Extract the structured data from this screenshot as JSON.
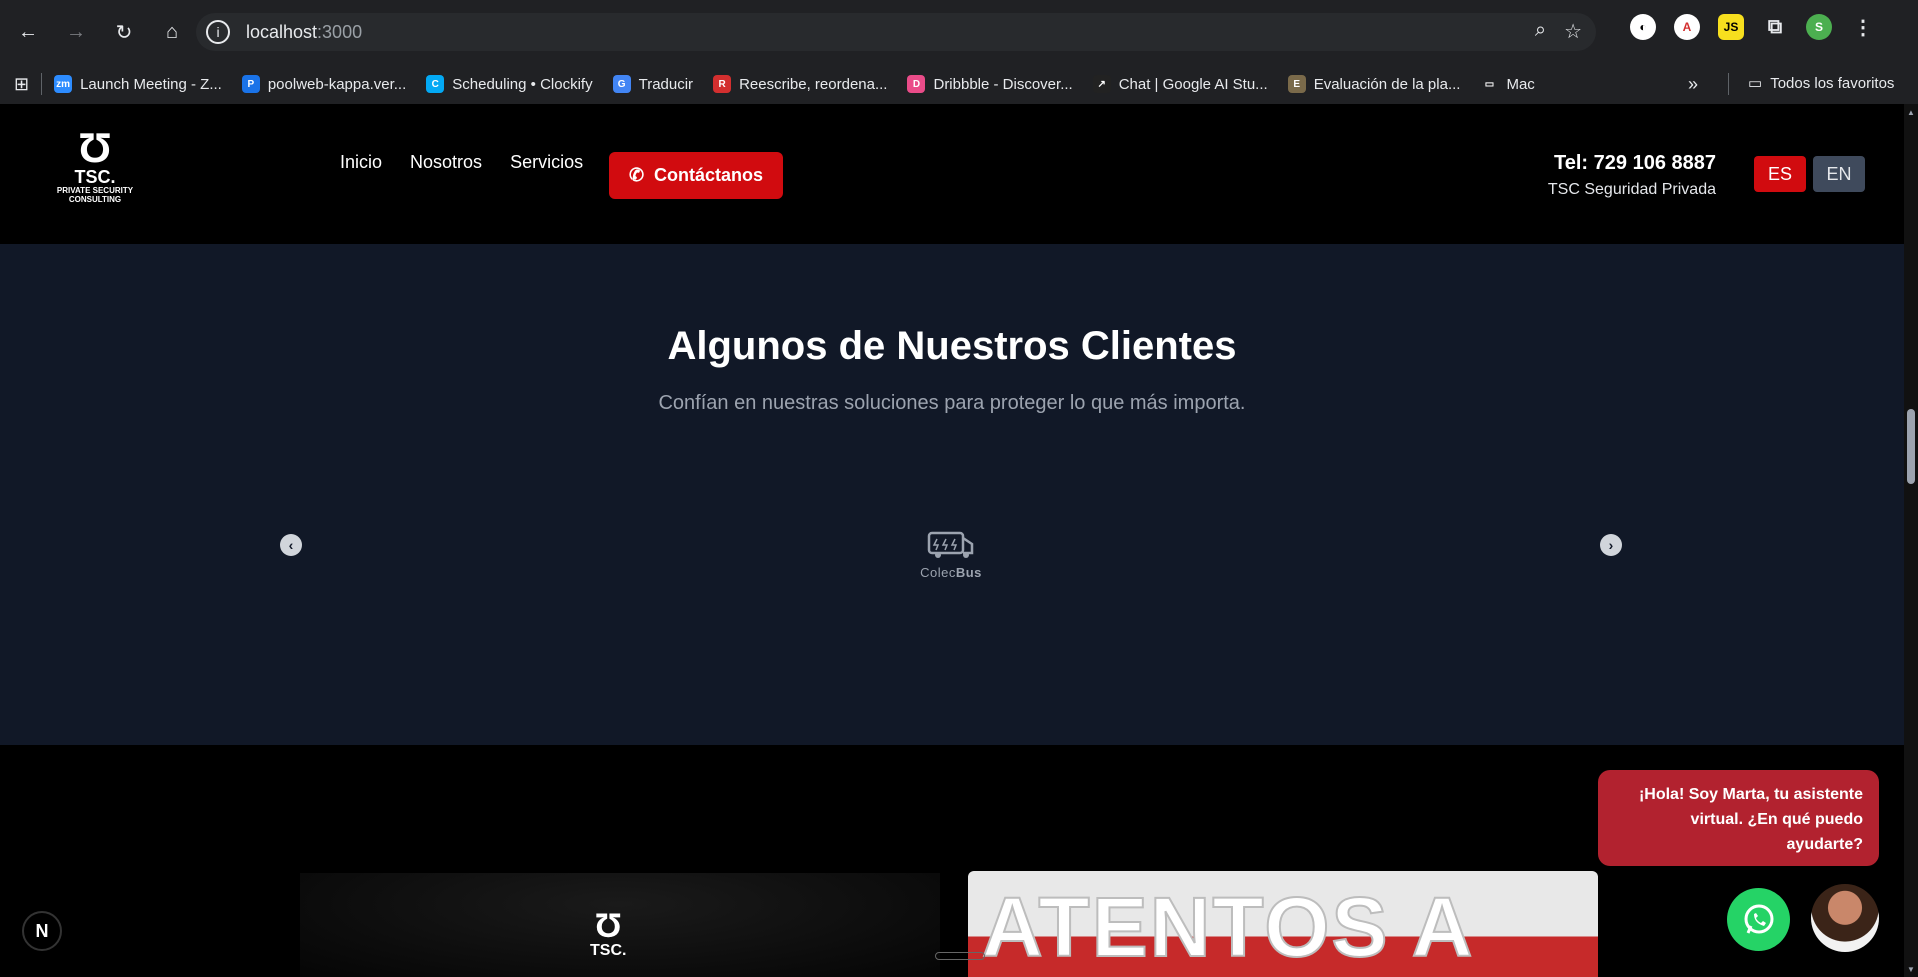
{
  "browser": {
    "url_host": "localhost",
    "url_port": ":3000",
    "avatar_letter": "S",
    "bookmarks": [
      {
        "label": "Launch Meeting - Z...",
        "icon": "zoom-icon",
        "color": "#2d8cff",
        "glyph": "zm"
      },
      {
        "label": "poolweb-kappa.ver...",
        "icon": "p-icon",
        "color": "#1a73e8",
        "glyph": "P"
      },
      {
        "label": "Scheduling • Clockify",
        "icon": "clockify-icon",
        "color": "#03a9f4",
        "glyph": "C"
      },
      {
        "label": "Traducir",
        "icon": "translate-icon",
        "color": "#4285f4",
        "glyph": "G"
      },
      {
        "label": "Reescribe, reordena...",
        "icon": "rewrite-icon",
        "color": "#d32f2f",
        "glyph": "R"
      },
      {
        "label": "Dribbble - Discover...",
        "icon": "dribbble-icon",
        "color": "#ea4c89",
        "glyph": "D"
      },
      {
        "label": "Chat | Google AI Stu...",
        "icon": "ai-studio-icon",
        "color": "#222222",
        "glyph": "↗"
      },
      {
        "label": "Evaluación de la pla...",
        "icon": "evaluacion-icon",
        "color": "#7a6a4a",
        "glyph": "E"
      },
      {
        "label": "Mac",
        "icon": "folder-icon",
        "color": "#202124",
        "glyph": "▭"
      }
    ],
    "all_bookmarks": "Todos los favoritos"
  },
  "header": {
    "logo_name": "TSC.",
    "logo_sub": "PRIVATE SECURITY CONSULTING",
    "nav": [
      "Inicio",
      "Nosotros",
      "Servicios"
    ],
    "contact_label": "Contáctanos",
    "tel": "Tel: 729 106 8887",
    "tel_sub": "TSC Seguridad Privada",
    "lang_es": "ES",
    "lang_en": "EN"
  },
  "clients": {
    "title": "Algunos de Nuestros Clientes",
    "subtitle": "Confían en nuestras soluciones para proteger lo que más importa.",
    "client_name_a": "Colec",
    "client_name_b": "Bus"
  },
  "footer": {
    "logo_name": "TSC.",
    "banner_text": "ATENTOS A"
  },
  "chat": {
    "bubble": "¡Hola! Soy Marta, tu asistente virtual. ¿En qué puedo ayudarte?"
  },
  "colors": {
    "accent_red": "#d10b0f",
    "section_bg": "#111827",
    "whatsapp": "#25d366"
  }
}
